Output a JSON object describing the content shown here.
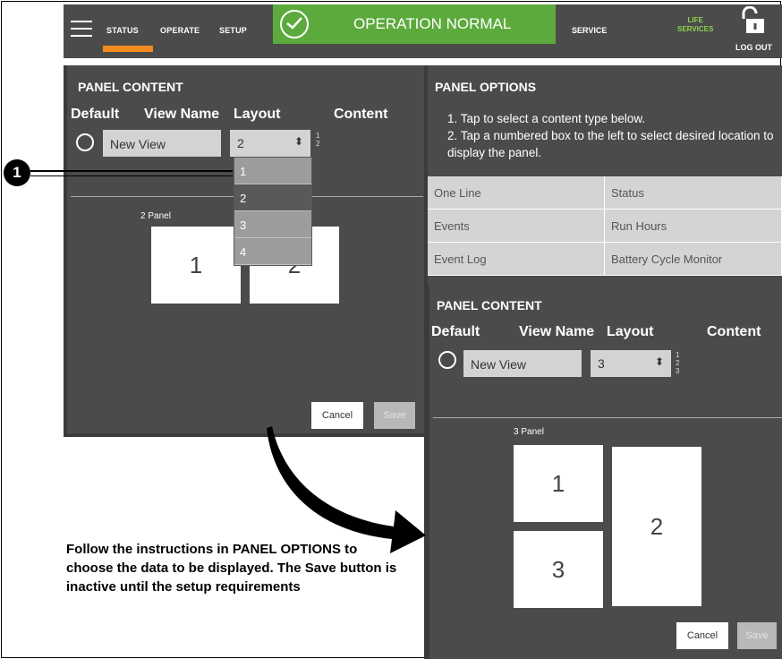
{
  "topbar": {
    "nav": [
      "STATUS",
      "OPERATE",
      "SETUP"
    ],
    "status": "OPERATION NORMAL",
    "service": "SERVICE",
    "life_line1": "LIFE",
    "life_line2": "SERVICES",
    "logout": "LOG OUT",
    "status_color": "#5caa3c",
    "active_color": "#f28c1e"
  },
  "left_panel": {
    "title": "PANEL CONTENT",
    "headers": {
      "default": "Default",
      "view_name": "View Name",
      "layout": "Layout",
      "content": "Content"
    },
    "view_name_value": "New View",
    "layout_value": "2",
    "content_nums": [
      "1",
      "2"
    ],
    "dropdown_options": [
      "1",
      "2",
      "3",
      "4"
    ],
    "dropdown_selected": "2",
    "preview_label": "2 Panel",
    "preview_boxes": [
      "1",
      "2"
    ],
    "cancel": "Cancel",
    "save": "Save"
  },
  "callout": {
    "number": "1"
  },
  "options_panel": {
    "title": "PANEL OPTIONS",
    "instructions": [
      "1. Tap to select a content type below.",
      "2. Tap a numbered box to the left to select desired location to display the panel."
    ],
    "options": [
      "One Line",
      "Status",
      "Events",
      "Run Hours",
      "Event Log",
      "Battery Cycle Monitor"
    ]
  },
  "right_panel": {
    "title": "PANEL CONTENT",
    "headers": {
      "default": "Default",
      "view_name": "View Name",
      "layout": "Layout",
      "content": "Content"
    },
    "view_name_value": "New View",
    "layout_value": "3",
    "content_nums": [
      "1",
      "2",
      "3"
    ],
    "preview_label": "3 Panel",
    "preview_boxes": [
      "1",
      "2",
      "3"
    ],
    "cancel": "Cancel",
    "save": "Save"
  },
  "caption": "Follow the instructions in PANEL OPTIONS to choose the data to be displayed. The Save button is inactive until the setup requirements"
}
